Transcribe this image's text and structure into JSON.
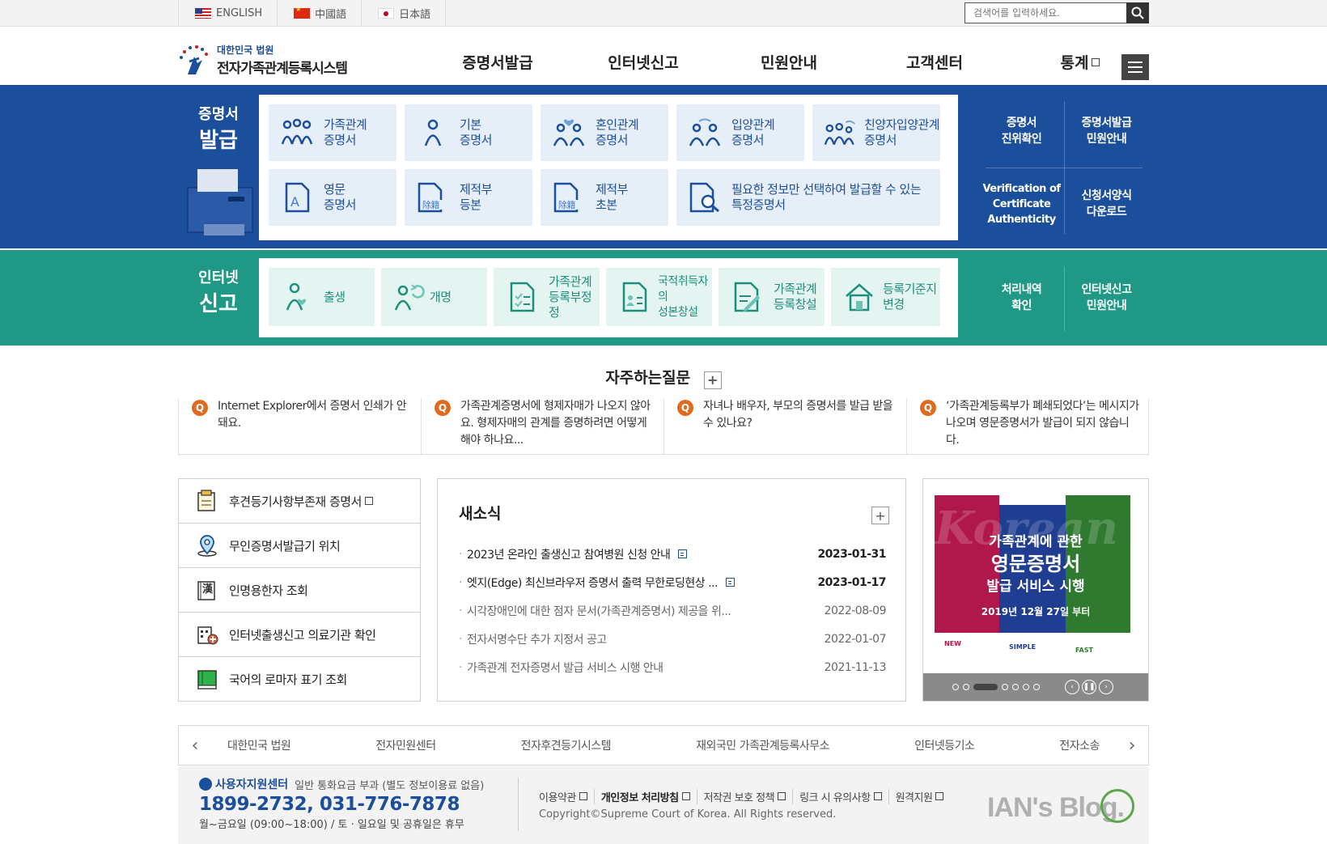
{
  "topbar": {
    "languages": [
      {
        "label": "ENGLISH",
        "flag": "us-flag-icon"
      },
      {
        "label": "中國語",
        "flag": "cn-flag-icon"
      },
      {
        "label": "日本語",
        "flag": "jp-flag-icon"
      }
    ],
    "search_placeholder": "검색어를 입력하세요."
  },
  "header": {
    "logo_line1": "대한민국 법원",
    "logo_line2": "전자가족관계등록시스템",
    "nav": [
      "증명서발급",
      "인터넷신고",
      "민원안내",
      "고객센터",
      "통계"
    ]
  },
  "certificates": {
    "label_line1": "증명서",
    "label_line2": "발급",
    "tiles_row1": [
      {
        "l1": "가족관계",
        "l2": "증명서"
      },
      {
        "l1": "기본",
        "l2": "증명서"
      },
      {
        "l1": "혼인관계",
        "l2": "증명서"
      },
      {
        "l1": "입양관계",
        "l2": "증명서"
      },
      {
        "l1": "친양자입양관계",
        "l2": "증명서"
      }
    ],
    "tiles_row2": [
      {
        "l1": "영문",
        "l2": "증명서"
      },
      {
        "l1": "제적부",
        "l2": "등본"
      },
      {
        "l1": "제적부",
        "l2": "초본"
      },
      {
        "l1": "필요한 정보만 선택하여 발급할 수 있는",
        "l2": "특정증명서"
      }
    ],
    "side": [
      {
        "l1": "증명서",
        "l2": "진위확인",
        "l3": ""
      },
      {
        "l1": "증명서발급",
        "l2": "민원안내",
        "l3": ""
      },
      {
        "l1": "Verification of",
        "l2": "Certificate",
        "l3": "Authenticity"
      },
      {
        "l1": "신청서양식",
        "l2": "다운로드",
        "l3": ""
      }
    ]
  },
  "reports": {
    "label_line1": "인터넷",
    "label_line2": "신고",
    "tiles": [
      {
        "l1": "출생",
        "l2": ""
      },
      {
        "l1": "개명",
        "l2": ""
      },
      {
        "l1": "가족관계",
        "l2": "등록부정정"
      },
      {
        "l1": "국적취득자의",
        "l2": "성본창설"
      },
      {
        "l1": "가족관계",
        "l2": "등록창설"
      },
      {
        "l1": "등록기준지",
        "l2": "변경"
      }
    ],
    "side": [
      {
        "l1": "처리내역",
        "l2": "확인"
      },
      {
        "l1": "인터넷신고",
        "l2": "민원안내"
      }
    ]
  },
  "faq": {
    "title": "자주하는질문",
    "badge": "Q",
    "items": [
      "Internet Explorer에서 증명서 인쇄가 안돼요.",
      "가족관계증명서에 형제자매가 나오지 않아요. 형제자매의 관계를 증명하려면 어떻게 해야 하나요...",
      "자녀나 배우자, 부모의 증명서를 발급 받을 수 있나요?",
      "‘가족관계등록부가 폐쇄되었다’는 메시지가 나오며 영문증명서가 발급이 되지 않습니다."
    ]
  },
  "quick_links": [
    {
      "label": "후견등기사항부존재 증명서",
      "icon": "document-icon",
      "external": true
    },
    {
      "label": "무인증명서발급기 위치",
      "icon": "location-pin-icon",
      "external": false
    },
    {
      "label": "인명용한자 조회",
      "icon": "hanja-book-icon",
      "external": false
    },
    {
      "label": "인터넷출생신고 의료기관 확인",
      "icon": "hospital-icon",
      "external": false
    },
    {
      "label": "국어의 로마자 표기 조회",
      "icon": "green-book-icon",
      "external": false
    }
  ],
  "news": {
    "title": "새소식",
    "items": [
      {
        "title": "2023년 온라인 출생신고 참여병원 신청 안내",
        "date": "2023-01-31",
        "hot": true
      },
      {
        "title": "엣지(Edge) 최신브라우저 증명서 출력 무한로딩현상 ...",
        "date": "2023-01-17",
        "hot": true
      },
      {
        "title": "시각장애인에 대한 점자 문서(가족관계증명서) 제공을 위...",
        "date": "2022-08-09",
        "hot": false
      },
      {
        "title": "전자서명수단 추가 지정서 공고",
        "date": "2022-01-07",
        "hot": false
      },
      {
        "title": "가족관계 전자증명서 발급 서비스 시행 안내",
        "date": "2021-11-13",
        "hot": false
      }
    ]
  },
  "banner": {
    "bg_text": "Korean",
    "headline1": "가족관계에 관한",
    "headline2": "영문증명서",
    "headline3": "발급 서비스 시행",
    "date_text": "2019년 12월 27일 부터",
    "tags": [
      "NEW",
      "SIMPLE",
      "FAST"
    ],
    "colors": [
      "#b0174a",
      "#1f3d91",
      "#2f7a2f"
    ]
  },
  "related": {
    "sites": [
      "대한민국 법원",
      "전자민원센터",
      "전자후견등기시스템",
      "재외국민 가족관계등록사무소",
      "인터넷등기소",
      "전자소송"
    ]
  },
  "footer": {
    "center_name": "사용자지원센터",
    "center_sub": "일반 통화요금 부과 (별도 정보이용료 없음)",
    "phone": "1899-2732, 031-776-7878",
    "hours": "월~금요일 (09:00~18:00) / 토 · 일요일 및 공휴일은 휴무",
    "links": [
      "이용약관",
      "개인정보 처리방침",
      "저작권 보호 정책",
      "링크 시 유의사항",
      "원격지원"
    ],
    "copyright": "Copyright©Supreme Court of Korea. All Rights reserved.",
    "watermark": "IAN's Blog."
  },
  "colors": {
    "primary": "#1b4f9c",
    "teal": "#1f9985",
    "faq_badge": "#e06a1f"
  }
}
